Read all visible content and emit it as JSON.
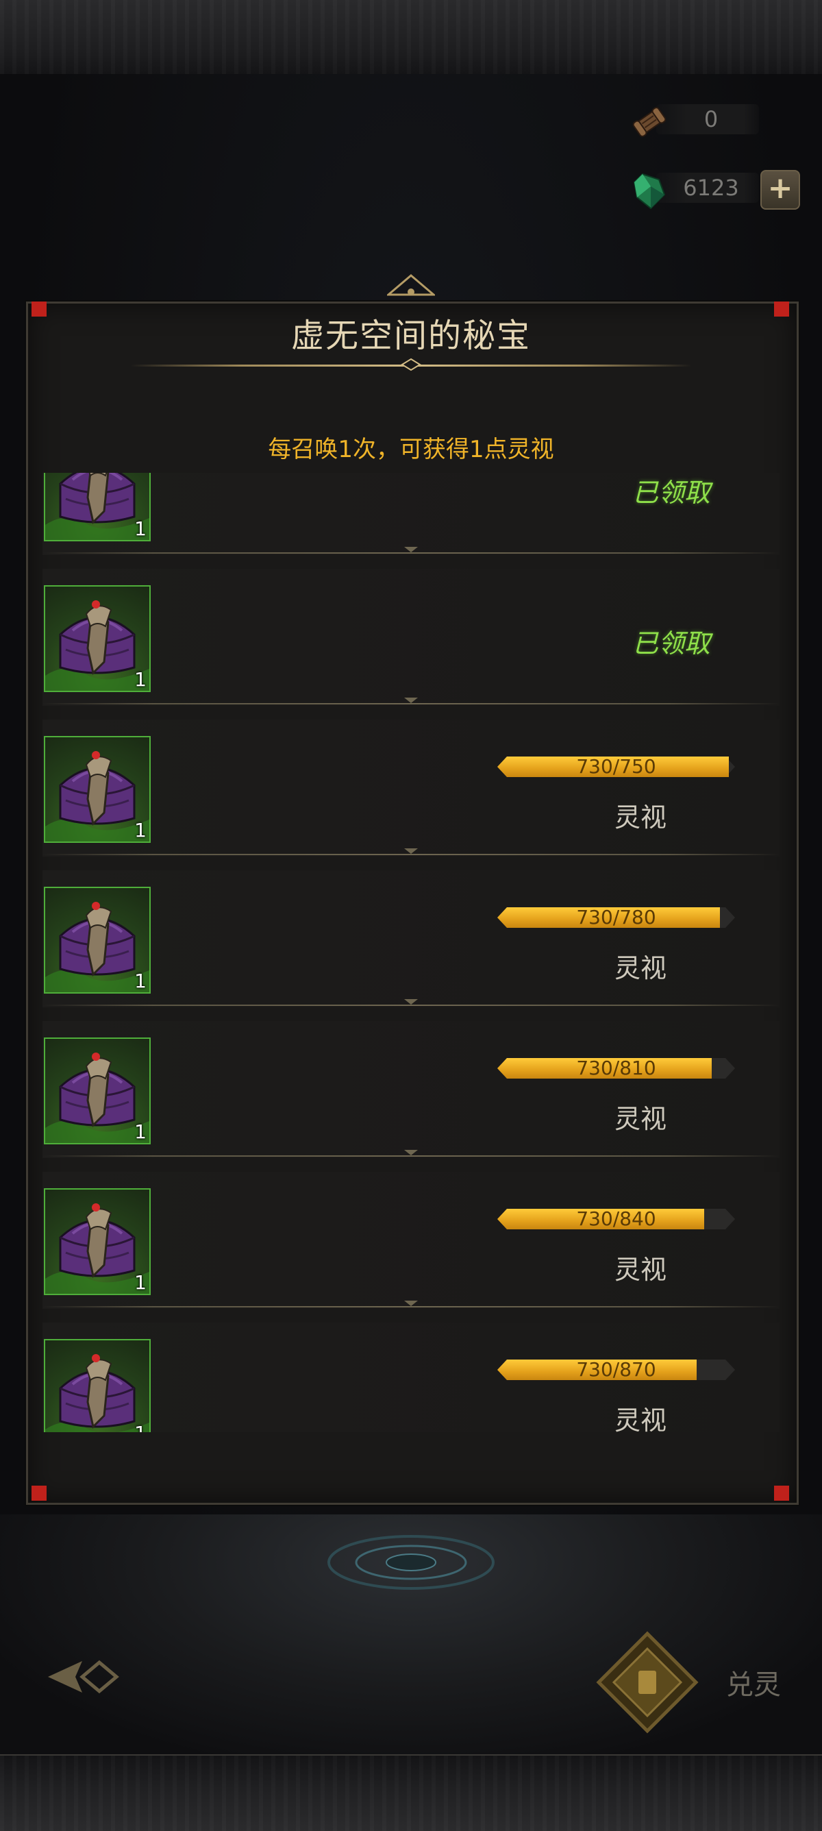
{
  "currencies": [
    {
      "icon": "scroll-icon",
      "value": "0"
    },
    {
      "icon": "green-gem-icon",
      "value": "6123",
      "add": "+"
    }
  ],
  "panel": {
    "title": "虚无空间的秘宝",
    "subtitle": "每召唤1次，可获得1点灵视"
  },
  "rows": [
    {
      "count": "1",
      "status": "已领取"
    },
    {
      "count": "1",
      "status": "已领取"
    },
    {
      "count": "1",
      "progress": "730/750",
      "current": 730,
      "target": 750,
      "reward": "灵视"
    },
    {
      "count": "1",
      "progress": "730/780",
      "current": 730,
      "target": 780,
      "reward": "灵视"
    },
    {
      "count": "1",
      "progress": "730/810",
      "current": 730,
      "target": 810,
      "reward": "灵视"
    },
    {
      "count": "1",
      "progress": "730/840",
      "current": 730,
      "target": 840,
      "reward": "灵视"
    },
    {
      "count": "1",
      "progress": "730/870",
      "current": 730,
      "target": 870,
      "reward": "灵视"
    }
  ],
  "footer": {
    "exchange_label": "兑灵"
  },
  "colors": {
    "accent_gold": "#f0b429",
    "claimed_green": "#8fe04a",
    "panel_bg": "#1a1918",
    "corner_red": "#c0211b"
  }
}
